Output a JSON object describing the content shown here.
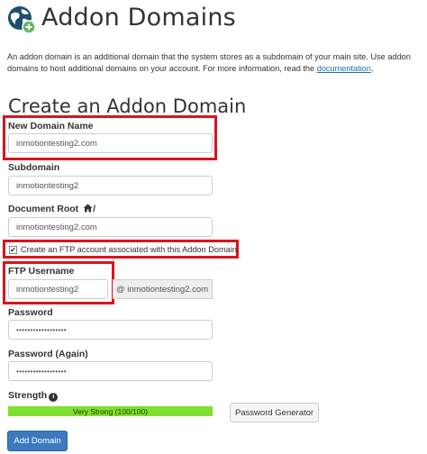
{
  "header": {
    "title": "Addon Domains"
  },
  "intro": {
    "text": "An addon domain is an additional domain that the system stores as a subdomain of your main site. Use addon domains to host additional domains on your account. For more information, read the ",
    "link_text": "documentation",
    "end": "."
  },
  "form": {
    "section_title": "Create an Addon Domain",
    "new_domain": {
      "label": "New Domain Name",
      "value": "inmotiontesting2.com"
    },
    "subdomain": {
      "label": "Subdomain",
      "value": "inmotiontesting2"
    },
    "document_root": {
      "label": "Document Root",
      "suffix": "/",
      "value": "inmotiontesting2.com"
    },
    "ftp_checkbox": {
      "label": "Create an FTP account associated with this Addon Domain.",
      "checked": true,
      "mark": "✔"
    },
    "ftp_username": {
      "label": "FTP Username",
      "value": "inmotiontesting2",
      "domain_suffix": "@ inmotiontesting2.com"
    },
    "password": {
      "label": "Password",
      "value": "••••••••••••••••••"
    },
    "password_again": {
      "label": "Password (Again)",
      "value": "••••••••••••••••••"
    },
    "strength": {
      "label": "Strength",
      "info_icon": "i",
      "bar_text": "Very Strong (100/100)",
      "level": 1.0,
      "bar_color": "#7fe02f"
    },
    "password_generator_label": "Password Generator",
    "submit_label": "Add Domain"
  },
  "colors": {
    "highlight": "#d9141e",
    "primary_button": "#3c7ac0",
    "link": "#1a6fb0"
  }
}
